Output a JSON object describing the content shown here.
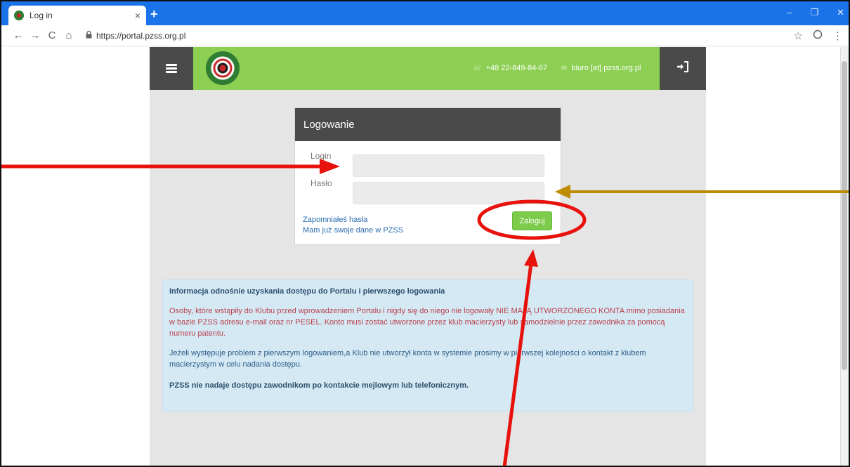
{
  "browser": {
    "tab_title": "Log in",
    "tab_close": "×",
    "new_tab": "+",
    "url": "https://portal.pzss.org.pl",
    "controls": {
      "minimize": "–",
      "restore": "❐",
      "close": "✕"
    },
    "nav": {
      "back": "←",
      "forward": "→",
      "reload": "C",
      "home": "⌂"
    },
    "bookmark": "☆",
    "menu": "⋮"
  },
  "site": {
    "nav": {
      "phone": "+48 22-849-84-67",
      "email": "biuro [at] pzss.org.pl"
    },
    "login": {
      "title": "Logowanie",
      "login_label": "Login",
      "password_label": "Hasło",
      "forgot_link": "Zapomniałeś hasła",
      "have_data_link": "Mam już swoje dane w PZSS",
      "submit": "Zaloguj"
    },
    "info": {
      "title": "Informacja odnośnie uzyskania dostępu do Portalu i pierwszego logowania",
      "para1": "Osoby, które wstąpiły do Klubu przed wprowadzeniem Portalu i nigdy się do niego nie logowały NIE MAJĄ UTWORZONEGO KONTA mimo posiadania w bazie PZSS adresu e-mail oraz nr PESEL. Konto musi zostać utworzone przez klub macierzysty lub samodzielnie przez zawodnika za pomocą numeru patentu.",
      "para2": "Jeżeli występuje problem z pierwszym logowaniem,a Klub nie utworzył konta w systemie prosimy w pierwszej kolejności o kontakt z klubem macierzystym w celu nadania dostępu.",
      "note": "PZSS nie nadaje dostępu zawodnikom po kontakcie mejlowym lub telefonicznym."
    }
  },
  "annotation_colors": {
    "red": "#e8120c",
    "gold": "#bf8c00"
  }
}
